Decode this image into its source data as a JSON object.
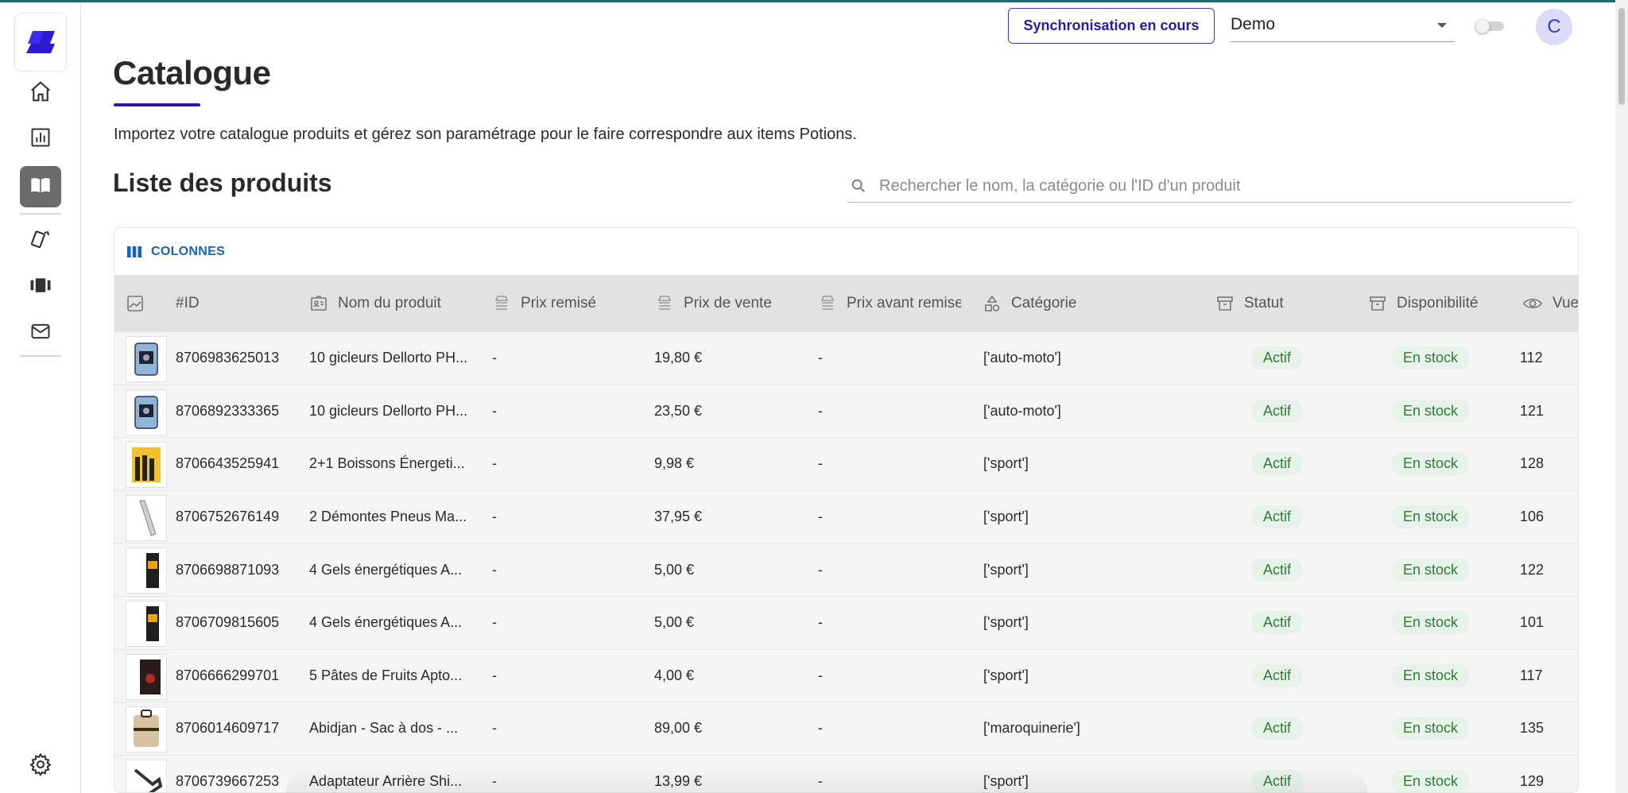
{
  "page": {
    "title": "Catalogue",
    "description": "Importez votre catalogue produits et gérez son paramétrage pour le faire correspondre aux items Potions.",
    "section_title": "Liste des produits"
  },
  "topbar": {
    "sync_label": "Synchronisation en cours",
    "account_select_value": "Demo",
    "avatar_initial": "C"
  },
  "search": {
    "placeholder": "Rechercher le nom, la catégorie ou l'ID d'un produit"
  },
  "sidebar": {
    "items": [
      {
        "name": "home",
        "icon": "home-icon"
      },
      {
        "name": "analytics",
        "icon": "bar-chart-icon"
      },
      {
        "name": "catalogue",
        "icon": "open-book-icon",
        "active": true
      },
      {
        "name": "cards",
        "icon": "cards-icon"
      },
      {
        "name": "carousel",
        "icon": "carousel-icon"
      },
      {
        "name": "email",
        "icon": "mail-icon"
      }
    ],
    "settings_icon": "gear-icon"
  },
  "toolbar": {
    "columns_label": "COLONNES"
  },
  "table": {
    "headers": {
      "image": "",
      "id": "#ID",
      "name": "Nom du produit",
      "discount_price": "Prix remisé",
      "sale_price": "Prix de vente",
      "price_before": "Prix avant remise",
      "category": "Catégorie",
      "status": "Statut",
      "availability": "Disponibilité",
      "views": "Vues"
    },
    "rows": [
      {
        "id": "8706983625013",
        "name": "10 gicleurs Dellorto PH...",
        "discount": "-",
        "price": "19,80 €",
        "before": "-",
        "category": "['auto-moto']",
        "status": "Actif",
        "availability": "En stock",
        "views": "112",
        "thumb": "blue-pack"
      },
      {
        "id": "8706892333365",
        "name": "10 gicleurs Dellorto PH...",
        "discount": "-",
        "price": "23,50 €",
        "before": "-",
        "category": "['auto-moto']",
        "status": "Actif",
        "availability": "En stock",
        "views": "121",
        "thumb": "blue-pack"
      },
      {
        "id": "8706643525941",
        "name": "2+1 Boissons Énergeti...",
        "discount": "-",
        "price": "9,98 €",
        "before": "-",
        "category": "['sport']",
        "status": "Actif",
        "availability": "En stock",
        "views": "128",
        "thumb": "yellow-pack"
      },
      {
        "id": "8706752676149",
        "name": "2 Démontes Pneus Ma...",
        "discount": "-",
        "price": "37,95 €",
        "before": "-",
        "category": "['sport']",
        "status": "Actif",
        "availability": "En stock",
        "views": "106",
        "thumb": "tool"
      },
      {
        "id": "8706698871093",
        "name": "4 Gels énergétiques A...",
        "discount": "-",
        "price": "5,00 €",
        "before": "-",
        "category": "['sport']",
        "status": "Actif",
        "availability": "En stock",
        "views": "122",
        "thumb": "gel"
      },
      {
        "id": "8706709815605",
        "name": "4 Gels énergétiques A...",
        "discount": "-",
        "price": "5,00 €",
        "before": "-",
        "category": "['sport']",
        "status": "Actif",
        "availability": "En stock",
        "views": "101",
        "thumb": "gel"
      },
      {
        "id": "8706666299701",
        "name": "5 Pâtes de Fruits Apto...",
        "discount": "-",
        "price": "4,00 €",
        "before": "-",
        "category": "['sport']",
        "status": "Actif",
        "availability": "En stock",
        "views": "117",
        "thumb": "red-box"
      },
      {
        "id": "8706014609717",
        "name": "Abidjan - Sac à dos - ...",
        "discount": "-",
        "price": "89,00 €",
        "before": "-",
        "category": "['maroquinerie']",
        "status": "Actif",
        "availability": "En stock",
        "views": "135",
        "thumb": "bag"
      },
      {
        "id": "8706739667253",
        "name": "Adaptateur Arrière Shi...",
        "discount": "-",
        "price": "13,99 €",
        "before": "-",
        "category": "['sport']",
        "status": "Actif",
        "availability": "En stock",
        "views": "129",
        "thumb": "adapter"
      }
    ]
  },
  "colors": {
    "brand": "#2a1a9c",
    "accent_top": "#1a6b6e",
    "link_blue": "#1565c0",
    "status_green": "#2e7d32",
    "status_bg": "#e7f3ea",
    "header_bg": "#e2e2e2"
  }
}
